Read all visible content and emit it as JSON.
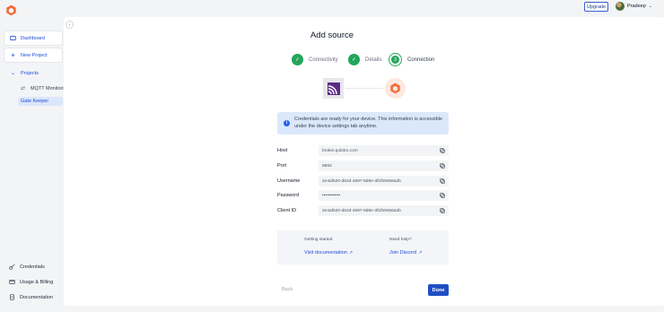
{
  "header": {
    "upgrade_label": "Upgrade",
    "user_name": "Pradeep"
  },
  "sidebar": {
    "dashboard": "Dashboard",
    "new_project": "New Project",
    "projects": "Projects",
    "project_item": "MQTT Monitori...",
    "gate_keeper": "Gate Keeper",
    "credentials": "Credentials",
    "usage_billing": "Usage & Billing",
    "documentation": "Documentation"
  },
  "main": {
    "title": "Add source",
    "steps": [
      {
        "label": "Connectivity",
        "state": "done"
      },
      {
        "label": "Details",
        "state": "done"
      },
      {
        "label": "Connection",
        "state": "current",
        "number": "3"
      }
    ],
    "info_text": "Credentials are ready for your device. This information is accessible under the device settings tab anytime.",
    "fields": [
      {
        "label": "Host",
        "value": "broker.qubitro.com"
      },
      {
        "label": "Port",
        "value": "8883"
      },
      {
        "label": "Username",
        "value": "2e4af520-d62d-4697-8d6e-3f1f59456a3b"
      },
      {
        "label": "Password",
        "value": "••••••••••••"
      },
      {
        "label": "Client ID",
        "value": "2e4af520-d62d-4697-8d6e-3f1f59456a3b"
      }
    ],
    "help": {
      "getting_started": "Getting started",
      "visit_docs": "Visit documentation",
      "need_help": "Need help?",
      "join_discord": "Join Discord"
    },
    "back_label": "Back",
    "done_label": "Done"
  },
  "colors": {
    "accent": "#1e4fc4",
    "success": "#22a65a",
    "brand": "#f26b3a"
  }
}
